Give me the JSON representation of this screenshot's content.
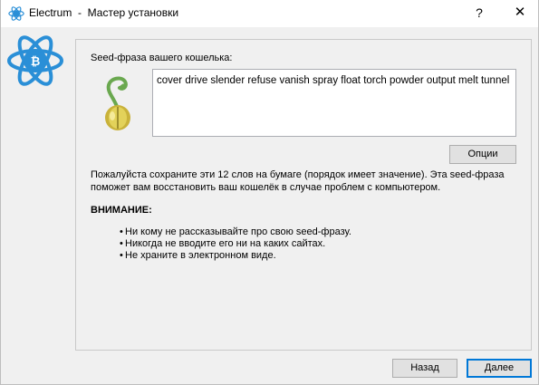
{
  "window": {
    "title": "Electrum  -  Мастер установки",
    "help_glyph": "?",
    "close_glyph": "✕",
    "app_icon": "electrum-bitcoin-icon"
  },
  "logo": {
    "icon": "electrum-bitcoin-logo"
  },
  "seed": {
    "label": "Seed-фраза вашего кошелька:",
    "phrase": "cover drive slender refuse vanish spray float torch powder output melt tunnel",
    "icon": "seed-sprout-icon",
    "options_label": "Опции"
  },
  "info": {
    "text": "Пожалуйста сохраните эти 12 слов на бумаге (порядок имеет значение). Эта seed-фраза поможет вам восстановить ваш кошелёк в случае проблем с компьютером."
  },
  "warning": {
    "title": "ВНИМАНИЕ:",
    "items": [
      "Ни кому не рассказывайте про свою seed-фразу.",
      "Никогда не вводите его ни на каких сайтах.",
      "Не храните в электронном виде."
    ]
  },
  "footer": {
    "back_label": "Назад",
    "next_label": "Далее"
  },
  "colors": {
    "accent": "#0078d7",
    "brand": "#2a8fd7"
  }
}
